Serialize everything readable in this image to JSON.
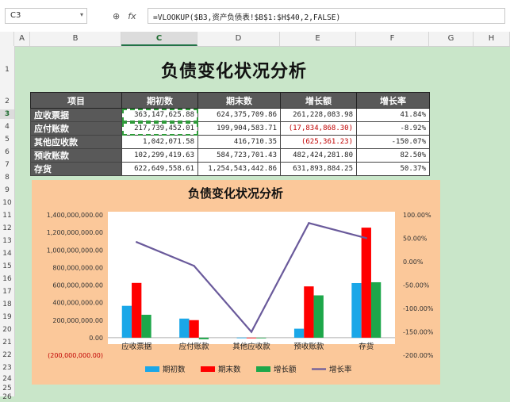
{
  "namebox": "C3",
  "fx_label": "fx",
  "formula": "=VLOOKUP($B3,资产负债表!$B$1:$H$40,2,FALSE)",
  "columns": [
    "A",
    "B",
    "C",
    "D",
    "E",
    "F",
    "G",
    "H"
  ],
  "rows": [
    "1",
    "2",
    "3",
    "4",
    "5",
    "6",
    "7",
    "8",
    "9",
    "10",
    "11",
    "12",
    "13",
    "14",
    "15",
    "16",
    "17",
    "18",
    "19",
    "20",
    "21",
    "22",
    "23",
    "24",
    "25",
    "26"
  ],
  "sheet_title": "负债变化状况分析",
  "table": {
    "headers": [
      "项目",
      "期初数",
      "期末数",
      "增长额",
      "增长率"
    ],
    "rows": [
      {
        "item": "应收票据",
        "begin": "363,147,625.88",
        "end": "624,375,709.86",
        "growth": "261,228,083.98",
        "rate": "41.84%"
      },
      {
        "item": "应付账款",
        "begin": "217,739,452.01",
        "end": "199,904,583.71",
        "growth": "(17,834,868.30)",
        "rate": "-8.92%"
      },
      {
        "item": "其他应收款",
        "begin": "1,042,071.58",
        "end": "416,710.35",
        "growth": "(625,361.23)",
        "rate": "-150.07%"
      },
      {
        "item": "预收账款",
        "begin": "102,299,419.63",
        "end": "584,723,701.43",
        "growth": "482,424,281.80",
        "rate": "82.50%"
      },
      {
        "item": "存货",
        "begin": "622,649,558.61",
        "end": "1,254,543,442.86",
        "growth": "631,893,884.25",
        "rate": "50.37%"
      }
    ]
  },
  "colors": {
    "begin": "#1aa7e8",
    "end": "#ff0000",
    "growth": "#1da74a",
    "rate": "#6a5a9b"
  },
  "chart_data": {
    "type": "bar",
    "title": "负债变化状况分析",
    "categories": [
      "应收票据",
      "应付账款",
      "其他应收款",
      "预收账款",
      "存货"
    ],
    "series": [
      {
        "name": "期初数",
        "type": "bar",
        "axis": "left",
        "values": [
          363147625.88,
          217739452.01,
          1042071.58,
          102299419.63,
          622649558.61
        ]
      },
      {
        "name": "期末数",
        "type": "bar",
        "axis": "left",
        "values": [
          624375709.86,
          199904583.71,
          416710.35,
          584723701.43,
          1254543442.86
        ]
      },
      {
        "name": "增长额",
        "type": "bar",
        "axis": "left",
        "values": [
          261228083.98,
          -17834868.3,
          -625361.23,
          482424281.8,
          631893884.25
        ]
      },
      {
        "name": "增长率",
        "type": "line",
        "axis": "right",
        "values": [
          41.84,
          -8.92,
          -150.07,
          82.5,
          50.37
        ]
      }
    ],
    "left_axis": {
      "range": [
        -200000000,
        1400000000
      ],
      "ticks": [
        "1,400,000,000.00",
        "1,200,000,000.00",
        "1,000,000,000.00",
        "800,000,000.00",
        "600,000,000.00",
        "400,000,000.00",
        "200,000,000.00",
        "0.00",
        "(200,000,000.00)"
      ]
    },
    "right_axis": {
      "range": [
        -200,
        100
      ],
      "ticks": [
        "100.00%",
        "50.00%",
        "0.00%",
        "-50.00%",
        "-100.00%",
        "-150.00%",
        "-200.00%"
      ]
    },
    "legend_position": "bottom",
    "grid": false
  }
}
